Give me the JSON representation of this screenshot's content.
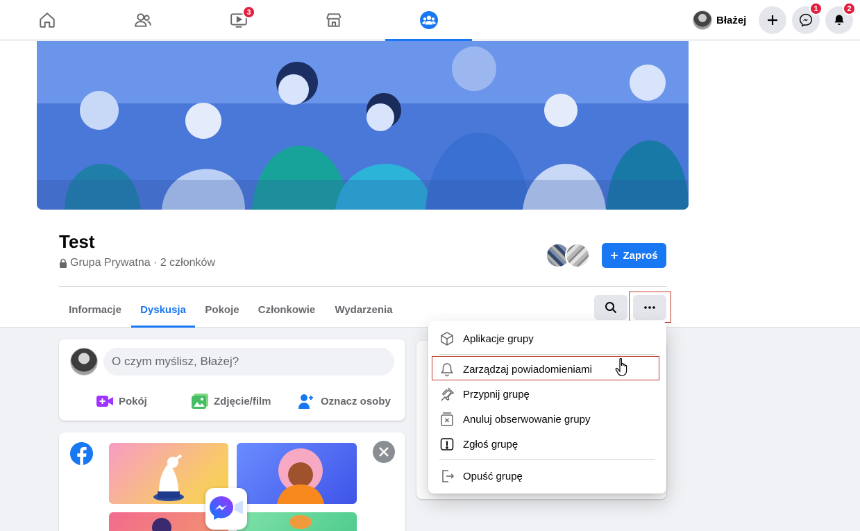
{
  "topnav": {
    "tabs": [
      {
        "name": "home",
        "icon": "home-icon"
      },
      {
        "name": "friends",
        "icon": "friends-icon"
      },
      {
        "name": "watch",
        "icon": "watch-icon",
        "badge": "3"
      },
      {
        "name": "marketplace",
        "icon": "marketplace-icon"
      },
      {
        "name": "groups",
        "icon": "groups-icon",
        "active": true
      }
    ],
    "profile_name": "Błażej",
    "messenger_badge": "1",
    "notifications_badge": "2"
  },
  "group": {
    "title": "Test",
    "meta": "Grupa Prywatna · 2 członków",
    "invite_label": "Zaproś",
    "tabs": [
      "Informacje",
      "Dyskusja",
      "Pokoje",
      "Członkowie",
      "Wydarzenia"
    ],
    "active_tab": "Dyskusja"
  },
  "composer": {
    "placeholder": "O czym myślisz, Błażej?",
    "actions": [
      "Pokój",
      "Zdjęcie/film",
      "Oznacz osoby"
    ]
  },
  "menu": {
    "items": [
      {
        "label": "Aplikacje grupy",
        "icon": "cube-icon"
      },
      {
        "label": "Zarządzaj powiadomieniami",
        "icon": "bell-icon",
        "highlighted": true
      },
      {
        "label": "Przypnij grupę",
        "icon": "pin-icon"
      },
      {
        "label": "Anuluj obserwowanie grupy",
        "icon": "unfollow-icon"
      },
      {
        "label": "Zgłoś grupę",
        "icon": "report-icon"
      },
      {
        "label": "Opuść grupę",
        "icon": "leave-icon"
      }
    ]
  },
  "colors": {
    "accent": "#1877f2",
    "badge": "#e41e3f",
    "highlight_outline": "#c0392b"
  }
}
